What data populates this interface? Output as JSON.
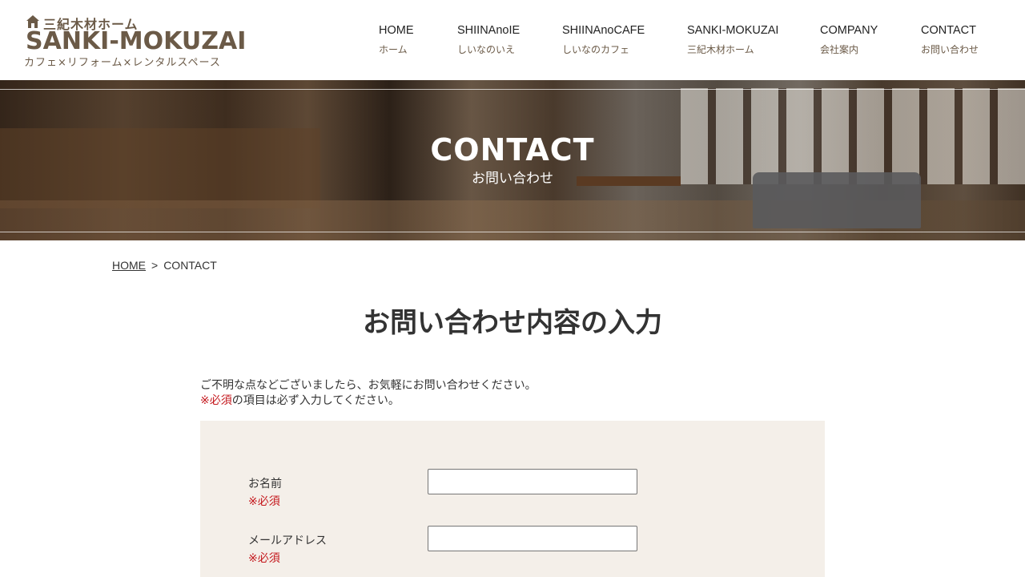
{
  "logo": {
    "jp": "三紀木材ホーム",
    "en": "SANKI-MOKUZAI",
    "sub": "カフェ×リフォーム×レンタルスペース",
    "icon": "house-icon",
    "color": "#6b5a47"
  },
  "nav": [
    {
      "en": "HOME",
      "jp": "ホーム"
    },
    {
      "en": "SHIINAnoIE",
      "jp": "しいなのいえ"
    },
    {
      "en": "SHIINAnoCAFE",
      "jp": "しいなのカフェ"
    },
    {
      "en": "SANKI-MOKUZAI",
      "jp": "三紀木材ホーム"
    },
    {
      "en": "COMPANY",
      "jp": "会社案内"
    },
    {
      "en": "CONTACT",
      "jp": "お問い合わせ"
    }
  ],
  "hero": {
    "title": "CONTACT",
    "subtitle": "お問い合わせ"
  },
  "breadcrumb": {
    "home": "HOME",
    "separator": ">",
    "current": "CONTACT"
  },
  "main": {
    "heading": "お問い合わせ内容の入力",
    "intro_line1": "ご不明な点などございましたら、お気軽にお問い合わせください。",
    "intro_required_mark": "※必須",
    "intro_line2_rest": "の項目は必ず入力してください。"
  },
  "form": {
    "fields": [
      {
        "label": "お名前",
        "required": "※必須",
        "value": ""
      },
      {
        "label": "メールアドレス",
        "required": "※必須",
        "value": ""
      }
    ]
  },
  "colors": {
    "accent_brown": "#6b5a47",
    "required_red": "#c4171c",
    "form_bg": "#f4efe9"
  }
}
